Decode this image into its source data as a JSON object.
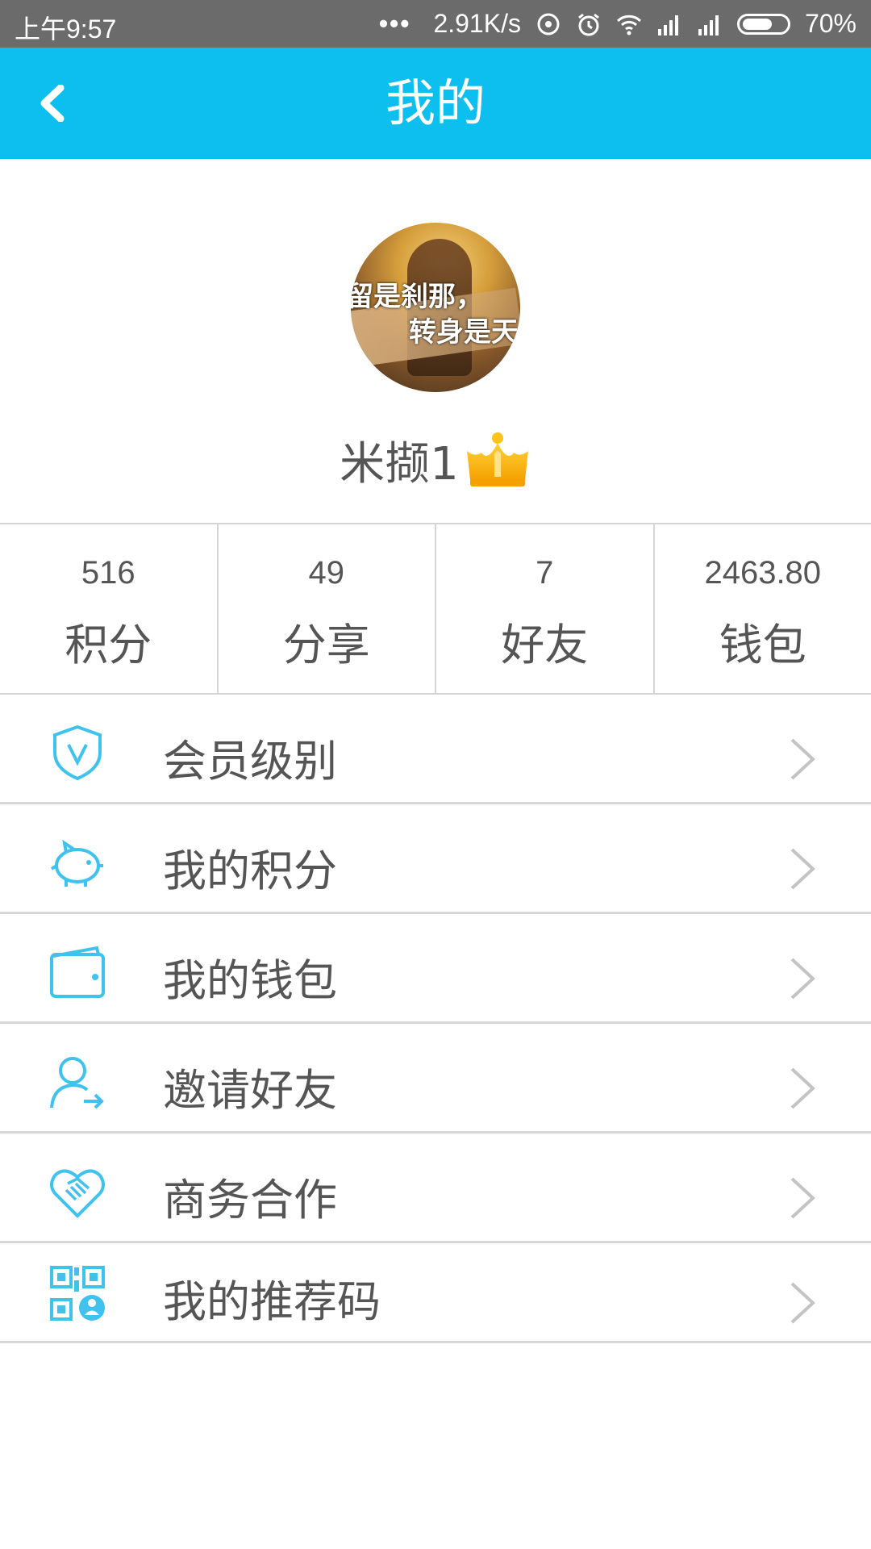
{
  "status_bar": {
    "time": "上午9:57",
    "dots": "•••",
    "speed": "2.91K/s",
    "battery": "70%",
    "battery_level": 0.7
  },
  "header": {
    "title": "我的",
    "back_icon": "back-chevron-icon",
    "color": "#0cbfee"
  },
  "profile": {
    "avatar_text_line1": "留是刹那，",
    "avatar_text_line2": "转身是天",
    "username": "米撷1",
    "badge_icon": "crown-icon"
  },
  "stats": [
    {
      "value": "516",
      "label": "积分"
    },
    {
      "value": "49",
      "label": "分享"
    },
    {
      "value": "7",
      "label": "好友"
    },
    {
      "value": "2463.80",
      "label": "钱包"
    }
  ],
  "menu": [
    {
      "label": "会员级别",
      "icon": "shield-v-icon"
    },
    {
      "label": "我的积分",
      "icon": "piggy-bank-icon"
    },
    {
      "label": "我的钱包",
      "icon": "wallet-icon"
    },
    {
      "label": "邀请好友",
      "icon": "invite-user-icon"
    },
    {
      "label": "商务合作",
      "icon": "handshake-icon"
    },
    {
      "label": "我的推荐码",
      "icon": "qr-code-icon"
    }
  ],
  "colors": {
    "accent": "#0cbfee",
    "icon": "#3fc3ee",
    "text": "#555555",
    "divider": "#d8d8d8"
  }
}
